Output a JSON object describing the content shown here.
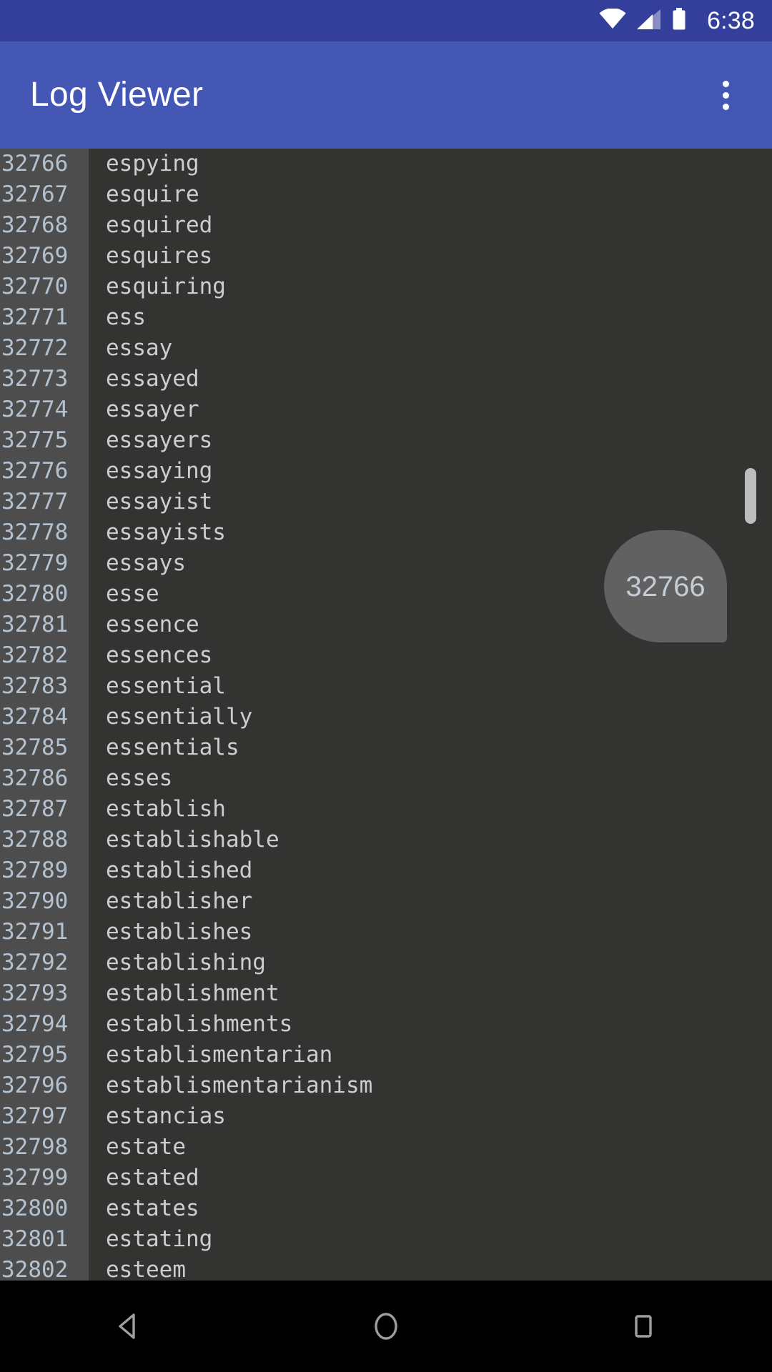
{
  "status_bar": {
    "clock": "6:38",
    "icons": [
      "wifi-icon",
      "cell-signal-icon",
      "battery-icon"
    ],
    "background_color": "#343f9b"
  },
  "app_bar": {
    "title": "Log Viewer",
    "overflow_menu": "overflow-menu-icon",
    "background_color": "#4557b5",
    "title_color": "#ffffff"
  },
  "log_view": {
    "background_color": "#333331",
    "gutter_color": "#4d4d4d",
    "lineno_color": "#b4c2d0",
    "text_color": "#cdcdcd",
    "rows": [
      {
        "line": "32766",
        "text": "espying"
      },
      {
        "line": "32767",
        "text": "esquire"
      },
      {
        "line": "32768",
        "text": "esquired"
      },
      {
        "line": "32769",
        "text": "esquires"
      },
      {
        "line": "32770",
        "text": "esquiring"
      },
      {
        "line": "32771",
        "text": "ess"
      },
      {
        "line": "32772",
        "text": "essay"
      },
      {
        "line": "32773",
        "text": "essayed"
      },
      {
        "line": "32774",
        "text": "essayer"
      },
      {
        "line": "32775",
        "text": "essayers"
      },
      {
        "line": "32776",
        "text": "essaying"
      },
      {
        "line": "32777",
        "text": "essayist"
      },
      {
        "line": "32778",
        "text": "essayists"
      },
      {
        "line": "32779",
        "text": "essays"
      },
      {
        "line": "32780",
        "text": "esse"
      },
      {
        "line": "32781",
        "text": "essence"
      },
      {
        "line": "32782",
        "text": "essences"
      },
      {
        "line": "32783",
        "text": "essential"
      },
      {
        "line": "32784",
        "text": "essentially"
      },
      {
        "line": "32785",
        "text": "essentials"
      },
      {
        "line": "32786",
        "text": "esses"
      },
      {
        "line": "32787",
        "text": "establish"
      },
      {
        "line": "32788",
        "text": "establishable"
      },
      {
        "line": "32789",
        "text": "established"
      },
      {
        "line": "32790",
        "text": "establisher"
      },
      {
        "line": "32791",
        "text": "establishes"
      },
      {
        "line": "32792",
        "text": "establishing"
      },
      {
        "line": "32793",
        "text": "establishment"
      },
      {
        "line": "32794",
        "text": "establishments"
      },
      {
        "line": "32795",
        "text": "establismentarian"
      },
      {
        "line": "32796",
        "text": "establismentarianism"
      },
      {
        "line": "32797",
        "text": "estancias"
      },
      {
        "line": "32798",
        "text": "estate"
      },
      {
        "line": "32799",
        "text": "estated"
      },
      {
        "line": "32800",
        "text": "estates"
      },
      {
        "line": "32801",
        "text": "estating"
      },
      {
        "line": "32802",
        "text": "esteem"
      }
    ]
  },
  "fast_scroll": {
    "label": "32766",
    "bubble_color": "#616161",
    "label_color": "#c4ccd6"
  },
  "scrollbar": {
    "thumb_color": "#bdbdbd"
  },
  "nav_bar": {
    "background_color": "#000000",
    "buttons": [
      {
        "name": "back-icon"
      },
      {
        "name": "home-icon"
      },
      {
        "name": "recents-icon"
      }
    ]
  }
}
